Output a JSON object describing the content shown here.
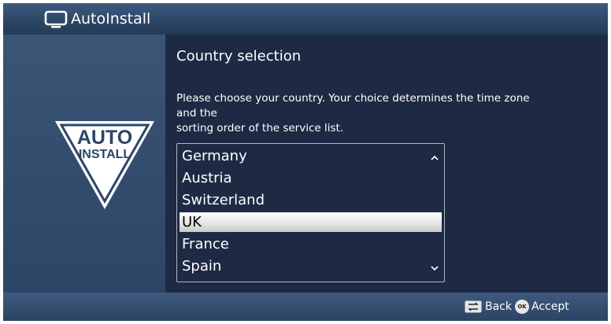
{
  "header": {
    "title": "AutoInstall",
    "icon": "tv-icon"
  },
  "logo": {
    "line1": "AUTO",
    "line2": "INSTALL"
  },
  "main": {
    "section_title": "Country selection",
    "description_line1": "Please choose your country. Your choice determines the time zone and the",
    "description_line2": "sorting order of the service list."
  },
  "country_list": {
    "items": [
      "Germany",
      "Austria",
      "Switzerland",
      "UK",
      "France",
      "Spain"
    ],
    "selected": "UK",
    "scroll_up_icon": "chevron-up-icon",
    "scroll_down_icon": "chevron-down-icon"
  },
  "footer": {
    "back_label": "Back",
    "back_icon": "back-arrows-icon",
    "ok_icon_text": "OK",
    "accept_label": "Accept"
  },
  "colors": {
    "background": "#1e2a44",
    "bar": "#2c4565",
    "panel": "#34506f",
    "selection": "#e8e8e8"
  }
}
